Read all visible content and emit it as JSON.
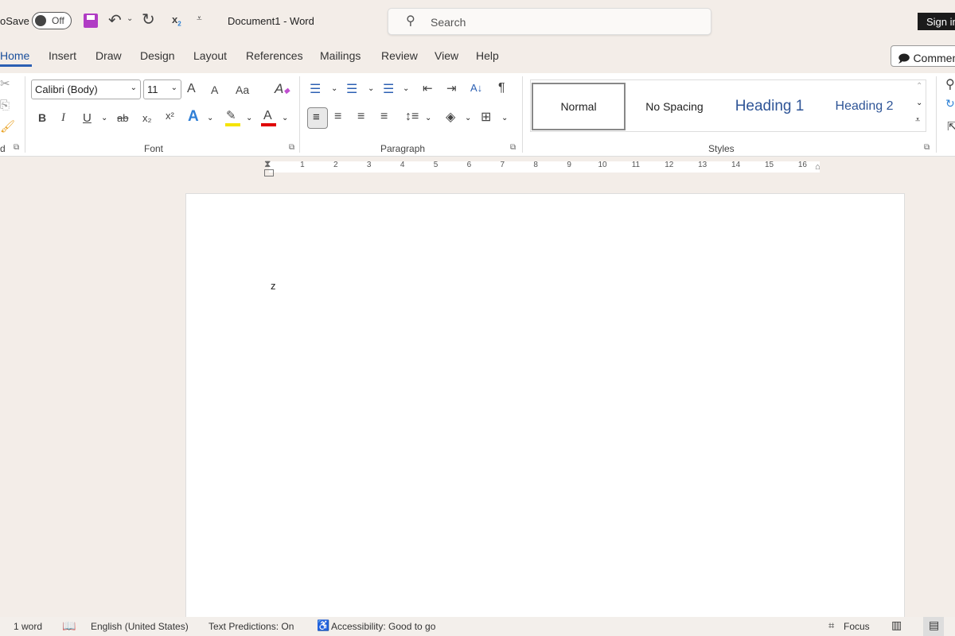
{
  "titlebar": {
    "autosave_label": "oSave",
    "autosave_state": "Off",
    "doc_title": "Document1  -  Word",
    "search_placeholder": "Search",
    "signin": "Sign in"
  },
  "tabs": [
    {
      "label": "Home",
      "active": true
    },
    {
      "label": "Insert"
    },
    {
      "label": "Draw"
    },
    {
      "label": "Design"
    },
    {
      "label": "Layout"
    },
    {
      "label": "References"
    },
    {
      "label": "Mailings"
    },
    {
      "label": "Review"
    },
    {
      "label": "View"
    },
    {
      "label": "Help"
    }
  ],
  "comments_label": "Comments",
  "font": {
    "name": "Calibri (Body)",
    "size": "11",
    "group_label": "Font",
    "grow": "A",
    "shrink": "A",
    "case": "Aa",
    "bold": "B",
    "italic": "I",
    "underline": "U",
    "strike": "ab",
    "sub": "x₂",
    "sup": "x²",
    "effects": "A",
    "highlight_color": "#f5e400",
    "font_color": "#e00000"
  },
  "paragraph": {
    "group_label": "Paragraph",
    "pilcrow": "¶",
    "sort": "A↓"
  },
  "clipboard": {
    "group_label": "d"
  },
  "styles": {
    "group_label": "Styles",
    "items": [
      "Normal",
      "No Spacing",
      "Heading 1",
      "Heading 2"
    ],
    "heading_color": "#2f5597"
  },
  "ruler": {
    "numbers": [
      "1",
      "2",
      "3",
      "4",
      "5",
      "6",
      "7",
      "8",
      "9",
      "10",
      "11",
      "12",
      "13",
      "14",
      "15",
      "16"
    ]
  },
  "document": {
    "text": "z"
  },
  "status": {
    "words": "1 word",
    "language": "English (United States)",
    "predictions": "Text Predictions: On",
    "accessibility": "Accessibility: Good to go",
    "focus": "Focus"
  }
}
